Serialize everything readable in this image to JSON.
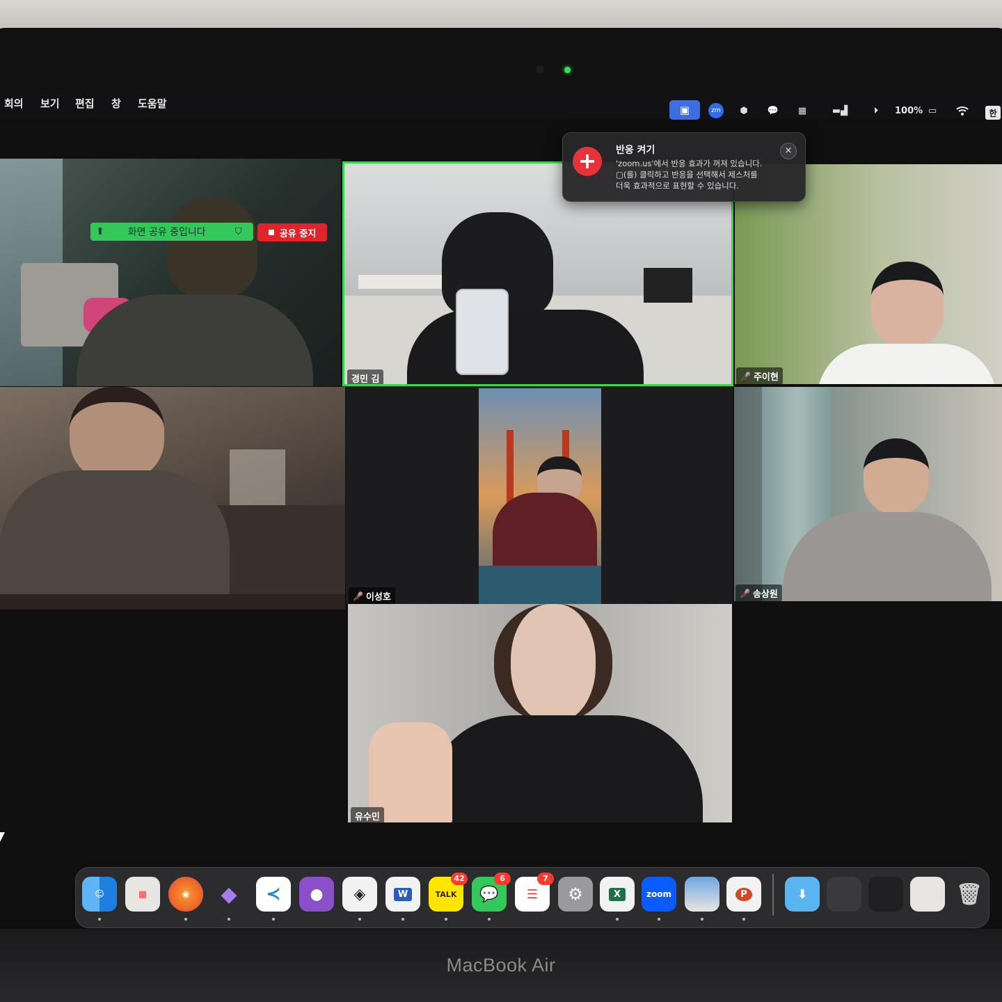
{
  "menu": {
    "items": [
      "회의",
      "보기",
      "편집",
      "창",
      "도움말"
    ]
  },
  "status_bar": {
    "battery": "100%",
    "input_method": "한",
    "icons": [
      "screen-share-icon",
      "zoom-icon",
      "hexagon-app-icon",
      "chat-record-icon",
      "keyboard-icon",
      "cat-status-icon",
      "play-icon",
      "battery-icon",
      "wifi-icon"
    ]
  },
  "notification": {
    "title": "반응 켜기",
    "line1": "'zoom.us'에서 반응 효과가 꺼져 있습니다.",
    "line2": "▢(를) 클릭하고 반응을 선택해서 제스처를",
    "line3": "더욱 효과적으로 표현할 수 있습니다.",
    "close": "×",
    "icon": "+"
  },
  "share": {
    "status": "화면 공유 중입니다",
    "stop": "공유 중지"
  },
  "participants": [
    {
      "name": "경민 김",
      "muted": false,
      "active": true
    },
    {
      "name": "주이현",
      "muted": true
    },
    {
      "name": "이성호",
      "muted": true
    },
    {
      "name": "송상원",
      "muted": true
    },
    {
      "name": "유수민",
      "muted": false
    }
  ],
  "dock": {
    "apps": [
      {
        "name": "Finder",
        "label": ""
      },
      {
        "name": "Launchpad",
        "label": ""
      },
      {
        "name": "Firefox",
        "label": ""
      },
      {
        "name": "Obsidian",
        "label": ""
      },
      {
        "name": "VS Code",
        "label": ""
      },
      {
        "name": "GitHub Desktop",
        "label": ""
      },
      {
        "name": "Copilot",
        "label": ""
      },
      {
        "name": "Word",
        "label": "W"
      },
      {
        "name": "KakaoTalk",
        "label": "TALK",
        "badge": "42"
      },
      {
        "name": "Messages",
        "label": "",
        "badge": "6"
      },
      {
        "name": "Reminders",
        "label": "",
        "badge": "7"
      },
      {
        "name": "System Settings",
        "label": ""
      },
      {
        "name": "Excel",
        "label": "X"
      },
      {
        "name": "Zoom",
        "label": "zoom"
      },
      {
        "name": "Preview",
        "label": ""
      },
      {
        "name": "PowerPoint",
        "label": "P"
      }
    ]
  },
  "device_brand": "MacBook Air"
}
